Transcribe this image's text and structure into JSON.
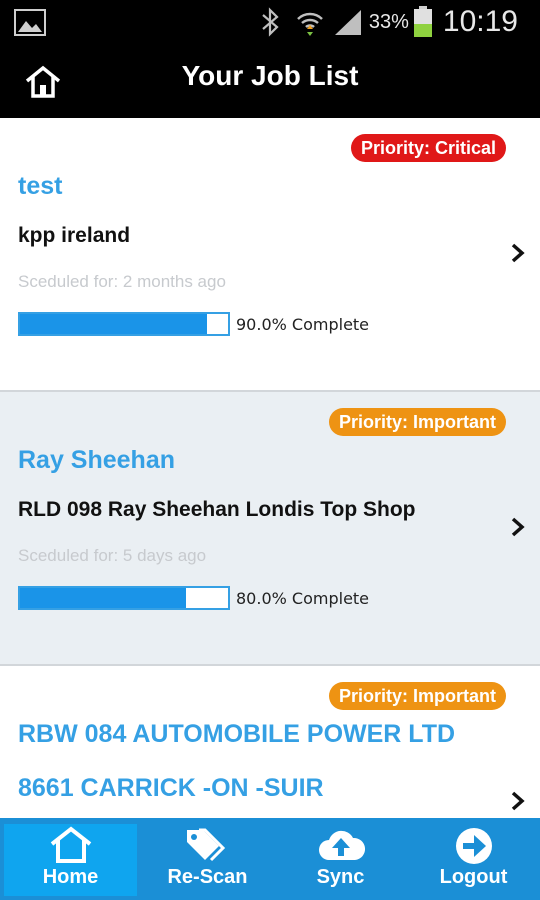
{
  "status_bar": {
    "battery_percent": "33%",
    "time": "10:19",
    "icons": [
      "gallery-icon",
      "bluetooth-icon",
      "wifi-icon",
      "signal-icon",
      "battery-icon"
    ]
  },
  "header": {
    "title": "Your Job List",
    "home_icon": "home-icon"
  },
  "jobs": [
    {
      "priority": "Priority: Critical",
      "priority_color": "#e01818",
      "name": "test",
      "site": "kpp ireland",
      "scheduled": "Sceduled for: 2 months ago",
      "progress": 0.9,
      "progress_label": "90.0% Complete"
    },
    {
      "priority": "Priority: Important",
      "priority_color": "#ee9313",
      "name": "Ray Sheehan",
      "site": "RLD 098 Ray Sheehan Londis Top Shop",
      "scheduled": "Sceduled for: 5 days ago",
      "progress": 0.8,
      "progress_label": "80.0% Complete"
    },
    {
      "priority": "Priority: Important",
      "priority_color": "#ee9313",
      "name": "RBW 084 AUTOMOBILE POWER LTD",
      "site": "8661 CARRICK -ON -SUIR"
    }
  ],
  "bottom_nav": {
    "items": [
      {
        "label": "Home",
        "icon": "home-icon",
        "active": true
      },
      {
        "label": "Re-Scan",
        "icon": "tag-icon",
        "active": false
      },
      {
        "label": "Sync",
        "icon": "cloud-upload-icon",
        "active": false
      },
      {
        "label": "Logout",
        "icon": "arrow-right-circle-icon",
        "active": false
      }
    ]
  },
  "colors": {
    "accent": "#35a0e4",
    "nav_bg": "#1b8fd6",
    "critical": "#e01818",
    "important": "#ee9313"
  }
}
